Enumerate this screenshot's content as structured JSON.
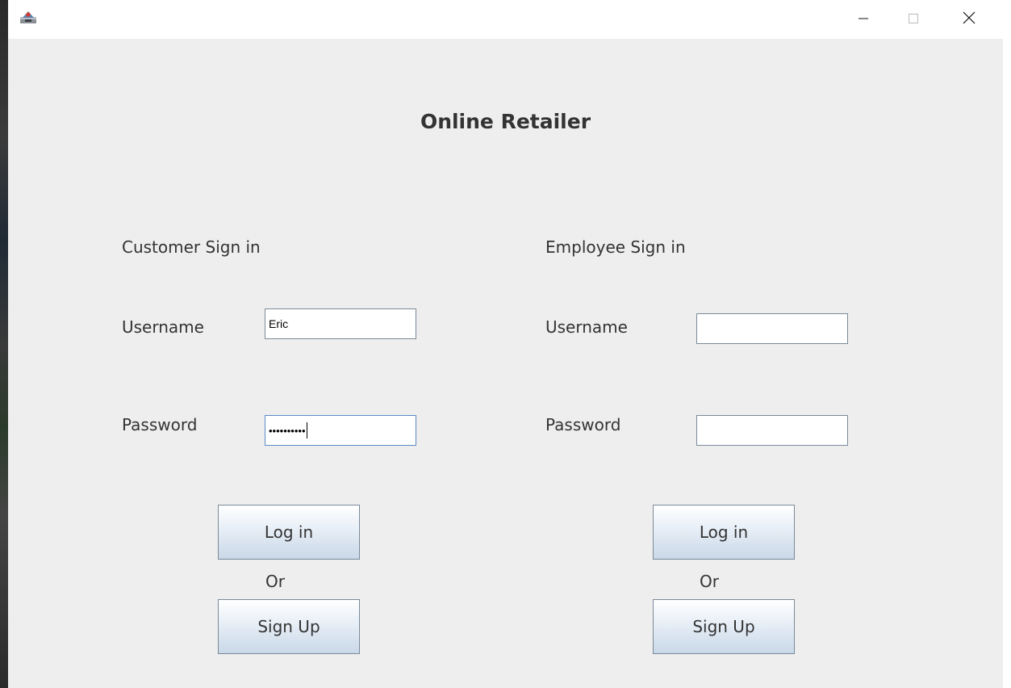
{
  "window": {
    "app_icon": "java-app-icon",
    "controls": {
      "minimize_icon": "minimize-icon",
      "maximize_icon": "maximize-icon",
      "close_icon": "close-icon"
    }
  },
  "main": {
    "title": "Online Retailer",
    "customer": {
      "heading": "Customer Sign in",
      "username_label": "Username",
      "username_value": "Eric",
      "password_label": "Password",
      "password_value": "••••••••••",
      "login_label": "Log in",
      "or_label": "Or",
      "signup_label": "Sign Up"
    },
    "employee": {
      "heading": "Employee Sign in",
      "username_label": "Username",
      "username_value": "",
      "password_label": "Password",
      "password_value": "",
      "login_label": "Log in",
      "or_label": "Or",
      "signup_label": "Sign Up"
    }
  },
  "colors": {
    "background": "#eeeeee",
    "titlebar": "#ffffff",
    "text": "#333333",
    "field_border": "#7a8a99",
    "button_gradient_top": "#ffffff",
    "button_gradient_bottom": "#c9d8e8"
  }
}
